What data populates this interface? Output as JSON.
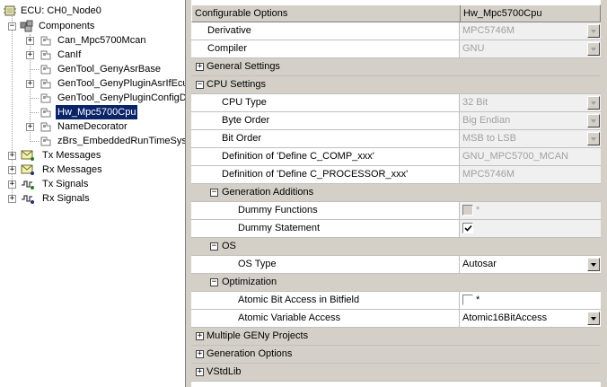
{
  "tree": {
    "ecu_label": "ECU: CH0_Node0",
    "components_label": "Components",
    "children": [
      {
        "label": "Can_Mpc5700Mcan",
        "expandable": true
      },
      {
        "label": "CanIf",
        "expandable": true
      },
      {
        "label": "GenTool_GenyAsrBase",
        "expandable": false
      },
      {
        "label": "GenTool_GenyPluginAsrIfEcu",
        "expandable": true
      },
      {
        "label": "GenTool_GenyPluginConfigD",
        "expandable": false
      },
      {
        "label": "Hw_Mpc5700Cpu",
        "expandable": false,
        "selected": true
      },
      {
        "label": "NameDecorator",
        "expandable": true
      },
      {
        "label": "zBrs_EmbeddedRunTimeSys",
        "expandable": false
      }
    ],
    "tx_messages": "Tx Messages",
    "rx_messages": "Rx Messages",
    "tx_signals": "Tx Signals",
    "rx_signals": "Rx Signals"
  },
  "grid": {
    "header_name": "Configurable Options",
    "header_value": "Hw_Mpc5700Cpu",
    "rows": {
      "derivative": {
        "name": "Derivative",
        "value": "MPC5746M"
      },
      "compiler": {
        "name": "Compiler",
        "value": "GNU"
      },
      "general_settings": {
        "name": "General Settings"
      },
      "cpu_settings": {
        "name": "CPU Settings"
      },
      "cpu_type": {
        "name": "CPU Type",
        "value": "32 Bit"
      },
      "byte_order": {
        "name": "Byte Order",
        "value": "Big Endian"
      },
      "bit_order": {
        "name": "Bit Order",
        "value": "MSB to LSB"
      },
      "def_comp": {
        "name": "Definition of 'Define C_COMP_xxx'",
        "value": "GNU_MPC5700_MCAN"
      },
      "def_proc": {
        "name": "Definition of 'Define C_PROCESSOR_xxx'",
        "value": "MPC5746M"
      },
      "gen_additions": {
        "name": "Generation Additions"
      },
      "dummy_functions": {
        "name": "Dummy Functions",
        "checked": false,
        "marker": "*"
      },
      "dummy_statement": {
        "name": "Dummy Statement",
        "checked": true
      },
      "os": {
        "name": "OS"
      },
      "os_type": {
        "name": "OS Type",
        "value": "Autosar"
      },
      "optimization": {
        "name": "Optimization"
      },
      "atomic_bit": {
        "name": "Atomic Bit Access in Bitfield",
        "checked": false,
        "marker": "*"
      },
      "atomic_var": {
        "name": "Atomic Variable Access",
        "value": "Atomic16BitAccess"
      },
      "multiple_geny": {
        "name": "Multiple GENy Projects"
      },
      "gen_options": {
        "name": "Generation Options"
      },
      "vstdlib": {
        "name": "VStdLib"
      }
    }
  },
  "expander": {
    "collapsed": "+",
    "expanded": "−"
  }
}
